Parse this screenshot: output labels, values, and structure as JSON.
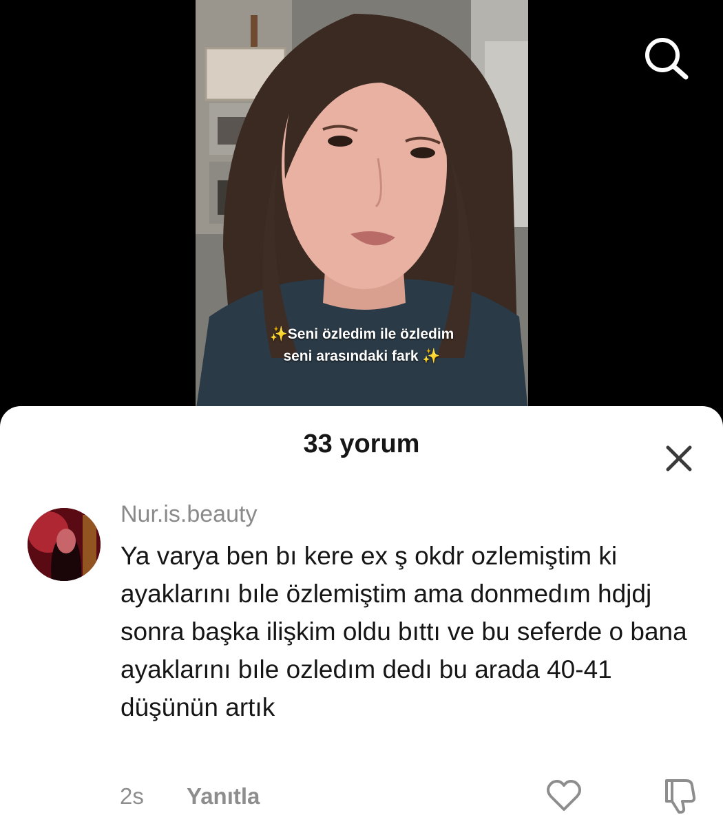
{
  "video": {
    "caption_line1": "Seni özledim ile özledim",
    "caption_line2": "seni arasındaki fark",
    "sparkle": "✨"
  },
  "header": {
    "search_icon": "search-icon"
  },
  "comments": {
    "title": "33 yorum",
    "close_icon": "close-icon",
    "items": [
      {
        "username": "Nur.is.beauty",
        "text": "Ya varya ben bı kere ex ş okdr ozlemiştim ki ayaklarını bıle özlemiştim ama donmedım hdjdj sonra başka ilişkim oldu bıttı ve bu seferde o bana ayaklarını bıle ozledım dedı bu arada 40-41 düşünün artık",
        "time": "2s",
        "reply_label": "Yanıtla"
      }
    ]
  },
  "colors": {
    "sheet_background": "#ffffff",
    "text_primary": "#161616",
    "text_secondary": "#8a8a8a"
  }
}
